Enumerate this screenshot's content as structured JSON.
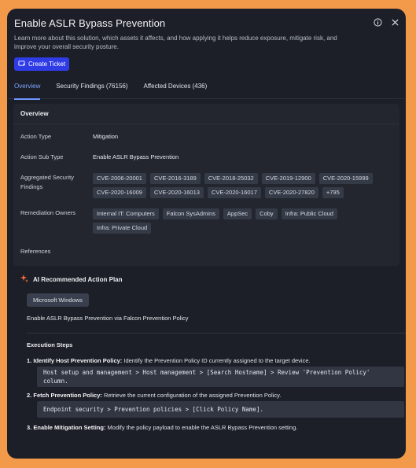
{
  "header": {
    "title": "Enable ASLR Bypass Prevention",
    "description": "Learn more about this solution, which assets it affects, and how applying it helps reduce exposure, mitigate risk, and improve your overall security posture.",
    "create_ticket_label": "Create Ticket",
    "info_icon": "info-icon",
    "close_icon": "close-icon"
  },
  "tabs": [
    {
      "label": "Overview",
      "active": true
    },
    {
      "label": "Security Findings (76156)",
      "active": false
    },
    {
      "label": "Affected Devices (436)",
      "active": false
    }
  ],
  "overview": {
    "title": "Overview",
    "action_type": {
      "label": "Action Type",
      "value": "Mitigation"
    },
    "action_sub_type": {
      "label": "Action Sub Type",
      "value": "Enable ASLR Bypass Prevention"
    },
    "aggregated": {
      "label": "Aggregated Security Findings",
      "chips": [
        "CVE-2006-20001",
        "CVE-2016-3189",
        "CVE-2018-25032",
        "CVE-2019-12900",
        "CVE-2020-15999",
        "CVE-2020-16009",
        "CVE-2020-16013",
        "CVE-2020-16017",
        "CVE-2020-27820",
        "+795"
      ]
    },
    "owners": {
      "label": "Remediation Owners",
      "chips": [
        "Internal IT: Computers",
        "Falcon SysAdmins",
        "AppSec",
        "Coby",
        "Infra: Public Cloud",
        "Infra: Private Cloud"
      ]
    },
    "references": {
      "label": "References"
    }
  },
  "ai_plan": {
    "title": "AI Recommended Action Plan",
    "os_button": "Microsoft Windows",
    "summary": "Enable ASLR Bypass Prevention via Falcon Prevention Policy",
    "steps_title": "Execution Steps",
    "steps": [
      {
        "num": "1.",
        "bold": "Identify Host Prevention Policy:",
        "text": " Identify the Prevention Policy ID currently assigned to the target device.",
        "code": "Host setup and management > Host management > [Search Hostname] > Review 'Prevention Policy' column."
      },
      {
        "num": "2.",
        "bold": "Fetch Prevention Policy:",
        "text": " Retrieve the current configuration of the assigned Prevention Policy.",
        "code": "Endpoint security > Prevention policies > [Click Policy Name]."
      },
      {
        "num": "3.",
        "bold": "Enable Mitigation Setting:",
        "text": " Modify the policy payload to enable the ASLR Bypass Prevention setting.",
        "code": ""
      }
    ]
  },
  "colors": {
    "accent": "#2f3ce6",
    "tab_active": "#7ea6ff",
    "frame": "#f39a4a",
    "panel": "#1c1f27",
    "ai_sparkle": "#ff6a3d"
  }
}
